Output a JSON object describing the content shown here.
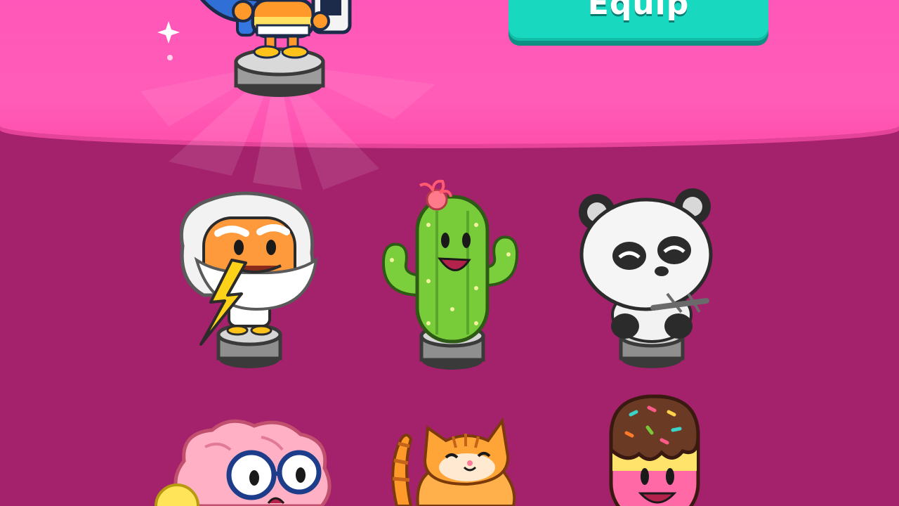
{
  "header": {
    "equip_label": "Equip",
    "selected_figure": "burger-kid-figure"
  },
  "collection": {
    "figures": [
      {
        "id": "zeus",
        "icon": "zeus-figure-icon"
      },
      {
        "id": "cactus",
        "icon": "cactus-figure-icon"
      },
      {
        "id": "panda",
        "icon": "panda-figure-icon"
      },
      {
        "id": "brain",
        "icon": "brain-figure-icon"
      },
      {
        "id": "cat",
        "icon": "cat-figure-icon"
      },
      {
        "id": "ice-pop",
        "icon": "ice-pop-figure-icon"
      }
    ]
  },
  "colors": {
    "header_pink": "#ff57b9",
    "background_magenta": "#a4216b",
    "equip_teal": "#18d9c0"
  }
}
